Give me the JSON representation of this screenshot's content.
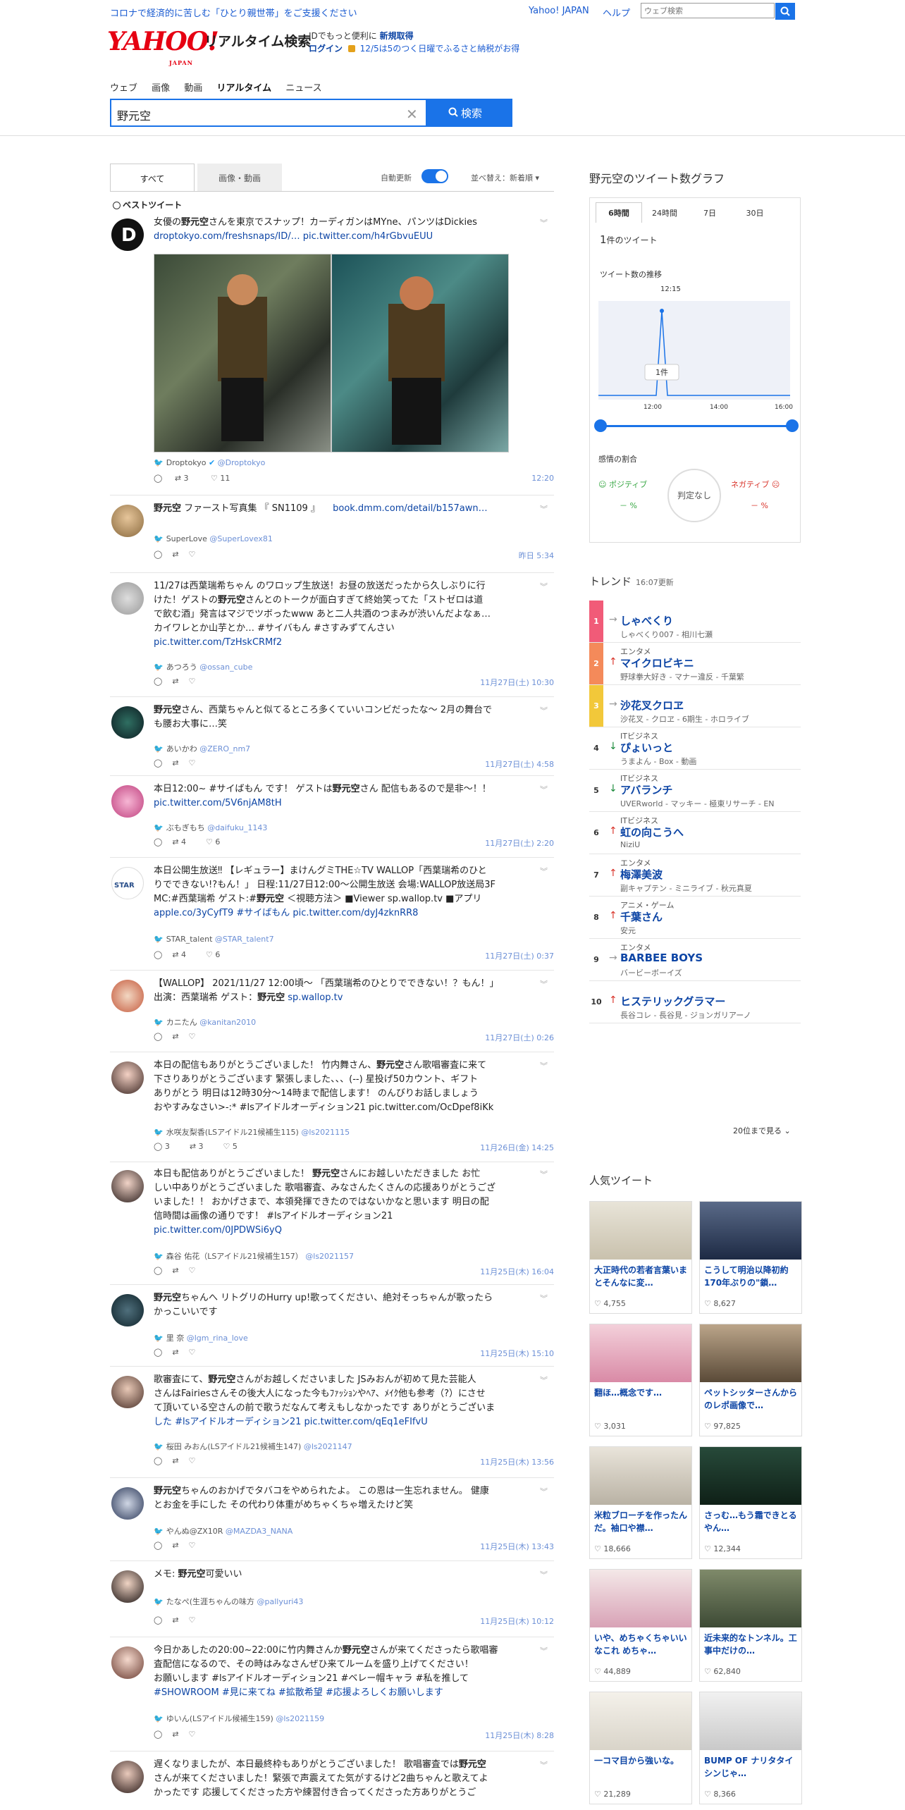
{
  "topbar": {
    "notice": "コロナで経済的に苦しむ「ひとり親世帯」をご支援ください",
    "yahoo_japan": "Yahoo! JAPAN",
    "help": "ヘルプ",
    "web_search_placeholder": "ウェブ検索"
  },
  "header": {
    "logo": "YAHOO!",
    "logo_sub": "JAPAN",
    "app_name": "リアルタイム検索",
    "id_prefix": "IDでもっと便利に",
    "register": "新規取得",
    "login": "ログイン",
    "promo": "12/5は5のつく日曜でふるさと納税がお得"
  },
  "service_tabs": [
    "ウェブ",
    "画像",
    "動画",
    "リアルタイム",
    "ニュース"
  ],
  "search": {
    "query": "野元空",
    "button": "検索"
  },
  "result_tabs": {
    "all": "すべて",
    "media": "画像・動画"
  },
  "auto_update": "自動更新",
  "sort": "並べ替え：新着順",
  "best_tweet": "ベストツイート",
  "tweets": [
    {
      "text_pre": "女優の",
      "keyword": "野元空",
      "text_post": "さんを東京でスナップ！カーディガンはMYne、パンツはDickies",
      "links": "droptokyo.com/freshsnaps/ID/… pic.twitter.com/h4rGbvuEUU",
      "author": "Droptokyo",
      "handle": "@Droptokyo",
      "retweets": "3",
      "likes": "11",
      "time": "12:20"
    },
    {
      "keyword": "野元空",
      "text_post": " ファースト写真集 『 SN1109 』",
      "links": "book.dmm.com/detail/b157awn…",
      "author": "SuperLove",
      "handle": "@SuperLovex81",
      "time": "昨日 5:34"
    },
    {
      "line1": "11/27は西葉瑞希ちゃん のワロップ生放送！お昼の放送だったから久しぶりに行",
      "line2_pre": "けた！ゲストの",
      "keyword": "野元空",
      "line2_post": "さんとのトークが面白すぎて終始笑ってた「ストゼロは道",
      "line3": "で飲む酒」発言はマジでツボったwww あと二人共酒のつまみが渋いんだよなぁ…",
      "line4": "カイワレとか山芋とか… #サイバもん #さすみずてんさい",
      "links": "pic.twitter.com/TzHskCRMf2",
      "author": "あつろう",
      "handle": "@ossan_cube",
      "time": "11月27日(土) 10:30"
    },
    {
      "keyword": "野元空",
      "text_post": "さん、西葉ちゃんと似てるところ多くていいコンビだったな〜 2月の舞台で",
      "line2": "も腰お大事に…笑",
      "author": "あいかわ",
      "handle": "@ZERO_nm7",
      "time": "11月27日(土) 4:58"
    },
    {
      "text_pre": "本日12:00~ #サイばもん です！ ゲストは",
      "keyword": "野元空",
      "text_post": "さん 配信もあるので是非〜！！",
      "links": "pic.twitter.com/5V6njAM8tH",
      "author": "ぶもぎもち",
      "handle": "@daifuku_1143",
      "retweets": "4",
      "likes": "6",
      "time": "11月27日(土) 2:20"
    },
    {
      "line1": "本日公開生放送‼ 【レギュラー】まけんグミTHE☆TV WALLOP「西葉瑞希のひと",
      "line2": "りでできない!?もん！」 日程:11/27日12:00～公開生放送 会場:WALLOP放送局3F",
      "line3_pre": "MC:#西葉瑞希 ゲスト:#",
      "keyword": "野元空",
      "line3_post": " ＜視聴方法＞ ■Viewer sp.wallop.tv ■アプリ",
      "line4": "apple.co/3yCyfT9 #サイばもん pic.twitter.com/dyJ4zknRR8",
      "author": "STAR_talent",
      "handle": "@STAR_talent7",
      "retweets": "4",
      "likes": "6",
      "time": "11月27日(土) 0:37"
    },
    {
      "line1": "【WALLOP】 2021/11/27 12:00頃～ 「西葉瑞希のひとりでできない！？もん！」",
      "line2_pre": "出演：西葉瑞希 ゲスト：",
      "keyword": "野元空",
      "line2_post": " sp.wallop.tv",
      "author": "カニたん",
      "handle": "@kanitan2010",
      "time": "11月27日(土) 0:26"
    },
    {
      "line1_pre": "本日の配信もありがとうございました！ 竹内舞さん、",
      "keyword": "野元空",
      "line1_post": "さん歌唱審査に来て",
      "line2": "下さりありがとうございます 緊張しました、、、(--) 星投げ50カウント、ギフト",
      "line3": "ありがとう 明日は12時30分～14時まで配信します！ のんびりお話しましょう",
      "line4": "おやすみなさい>-:* #lsアイドルオーディション21 pic.twitter.com/OcDpef8iKk",
      "author": "水咲友梨香(LSアイドル21候補生115)",
      "handle": "@ls2021115",
      "replies": "3",
      "retweets": "3",
      "likes": "5",
      "time": "11月26日(金) 14:25"
    },
    {
      "line1_pre": "本日も配信ありがとうございました！ ",
      "keyword": "野元空",
      "line1_post": "さんにお越しいただきました お忙",
      "line2": "しい中ありがとうございました 歌唱審査、みなさんたくさんの応援ありがとうござ",
      "line3": "いました！！ おかげさまで、本領発揮できたのではないかなと思います 明日の配",
      "line4": "信時間は画像の通りです！ #lsアイドルオーディション21",
      "links": "pic.twitter.com/0JPDWSi6yQ",
      "author": "森谷 佑花（LSアイドル21候補生157）",
      "handle": "@ls2021157",
      "time": "11月25日(木) 16:04"
    },
    {
      "keyword": "野元空",
      "text_post": "ちゃんへ リトグリのHurry up!歌ってください、絶対そっちゃんが歌ったら",
      "line2": "かっこいいです",
      "author": "里 奈",
      "handle": "@lgm_rina_love",
      "time": "11月25日(木) 15:10"
    },
    {
      "line1_pre": "歌審査にて、",
      "keyword": "野元空",
      "line1_post": "さんがお越しくださいました JSみおんが初めて見た芸能人",
      "line2": "さんはFairiesさんその後大人になった今もﾌｧｯｼｮﾝやﾍｱ、ﾒｲｸ他も参考（?）にさせ",
      "line3": "て頂いている空さんの前で歌うだなんて考えもしなかったです ありがとうございま",
      "line4": "した #lsアイドルオーディション21 pic.twitter.com/qEq1eFIfvU",
      "author": "桜田 みおん(LSアイドル21候補生147)",
      "handle": "@ls2021147",
      "time": "11月25日(木) 13:56"
    },
    {
      "keyword": "野元空",
      "text_post": "ちゃんのおかげでタバコをやめられたよ。 この恩は一生忘れません。 健康",
      "line2": "とお金を手にした その代わり体重がめちゃくちゃ増えたけど笑",
      "author": "やんぬ@ZX10R",
      "handle": "@MAZDA3_NANA",
      "time": "11月25日(木) 13:43"
    },
    {
      "text_pre": "メモ: ",
      "keyword": "野元空",
      "text_post": "可愛いい",
      "author": "たなぺ(生涯ちゃんの味方",
      "handle": "@pallyuri43",
      "time": "11月25日(木) 10:12"
    },
    {
      "line1_pre": "今日かあしたの20:00~22:00に竹内舞さんか",
      "keyword": "野元空",
      "line1_post": "さんが来てくださったら歌唱審",
      "line2": "査配信になるので、その時はみなさんぜひ来てルームを盛り上げてください！",
      "line3": "お願いします #lsアイドルオーディション21 #ベレー帽キャラ #私を推して",
      "line4": "#SHOWROOM #見に来てね #拡散希望 #応援よろしくお願いします",
      "author": "ゆいん(LSアイドル候補生159)",
      "handle": "@ls2021159",
      "time": "11月25日(木) 8:28"
    },
    {
      "line1_pre": "遅くなりましたが、本日最終枠もありがとうございました！ 歌唱審査では",
      "keyword": "野元空",
      "line2": "さんが来てくださいました！緊張で声震えてた気がするけど2曲ちゃんと歌えてよ",
      "line3": "かったです 応援してくださった方や練習付き合ってくださった方ありがとうご"
    }
  ],
  "right": {
    "graph_title": "野元空のツイート数グラフ",
    "ranges": [
      "6時間",
      "24時間",
      "7日",
      "30日"
    ],
    "count_value": "1",
    "count_unit": "件のツイート",
    "trend_label": "ツイート数の推移",
    "peak_time": "12:15",
    "peak_label": "1件",
    "peak_value": 1,
    "axis": [
      "12:00",
      "14:00",
      "16:00"
    ],
    "sentiment_title": "感情の割合",
    "positive": "ポジティブ",
    "negative": "ネガティブ",
    "judge": "判定なし",
    "positive_value": "－ %",
    "negative_value": "－ %",
    "trend_title": "トレンド",
    "trend_updated": "16:07更新",
    "trends": [
      {
        "rank": "1",
        "cat": "",
        "name": "しゃべくり",
        "desc": "しゃべくり007 - 相川七瀬",
        "dir": "→"
      },
      {
        "rank": "2",
        "cat": "エンタメ",
        "name": "マイクロビキニ",
        "desc": "野球拳大好き - マナー違反 - 千葉繁",
        "dir": "↑"
      },
      {
        "rank": "3",
        "cat": "",
        "name": "沙花叉クロヱ",
        "desc": "沙花叉 - クロヱ - 6期生 - ホロライブ",
        "dir": "→"
      },
      {
        "rank": "4",
        "cat": "ITビジネス",
        "name": "ぴょいっと",
        "desc": "うまよん - Box - 動画",
        "dir": "↓"
      },
      {
        "rank": "5",
        "cat": "ITビジネス",
        "name": "アバランチ",
        "desc": "UVERworld - マッキー - 極東リサーチ - EN",
        "dir": "↓"
      },
      {
        "rank": "6",
        "cat": "ITビジネス",
        "name": "虹の向こうへ",
        "desc": "NiziU",
        "dir": "↑"
      },
      {
        "rank": "7",
        "cat": "エンタメ",
        "name": "梅澤美波",
        "desc": "副キャプテン - ミニライブ - 秋元真夏",
        "dir": "↑"
      },
      {
        "rank": "8",
        "cat": "アニメ・ゲーム",
        "name": "千葉さん",
        "desc": "安元",
        "dir": "↑"
      },
      {
        "rank": "9",
        "cat": "エンタメ",
        "name": "BARBEE BOYS",
        "desc": "バービーボーイズ",
        "dir": "→"
      },
      {
        "rank": "10",
        "cat": "",
        "name": "ヒステリックグラマー",
        "desc": "長谷コレ - 長谷見 - ジョンガリアーノ",
        "dir": "↑"
      }
    ],
    "see_more": "20位まで見る",
    "popular_title": "人気ツイート",
    "popular": [
      {
        "caption": "大正時代の若者言葉いまとそんなに変…",
        "likes": "4,755"
      },
      {
        "caption": "こうして明治以降初約170年ぶりの\"鎖…",
        "likes": "8,627"
      },
      {
        "caption": "翻ほ…概念です…",
        "likes": "3,031"
      },
      {
        "caption": "ペットシッターさんからのレポ画像で…",
        "likes": "97,825"
      },
      {
        "caption": "米粒ブローチを作ったんだ。袖口や襟…",
        "likes": "18,666"
      },
      {
        "caption": "さっむ…もう霜できとるやん…",
        "likes": "12,344"
      },
      {
        "caption": "いや、めちゃくちゃいいなこれ めちゃ…",
        "likes": "44,889"
      },
      {
        "caption": "近未来的なトンネル。工事中だけの…",
        "likes": "62,840"
      },
      {
        "caption": "一コマ目から強いな。",
        "likes": "21,289"
      },
      {
        "caption": "BUMP OF ナリタタイシンじゃ…",
        "likes": "8,366"
      }
    ]
  }
}
